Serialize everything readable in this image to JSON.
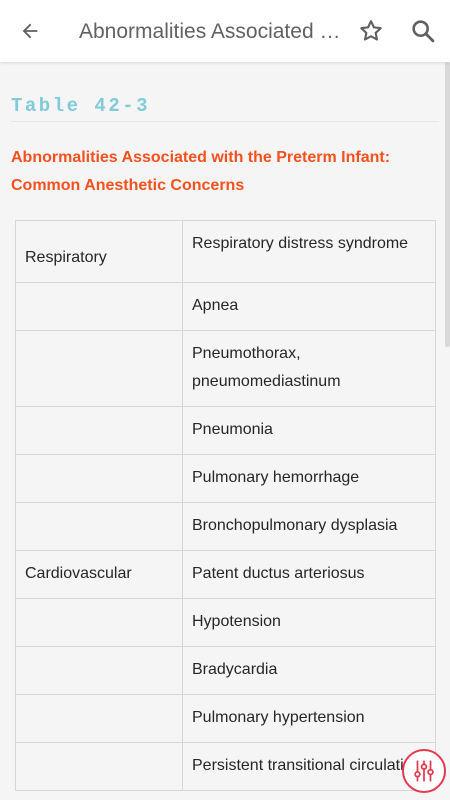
{
  "appbar": {
    "title": "Abnormalities Associated with the Preterm Infant: Common Anesthetic Concerns"
  },
  "table_label": "Table 42-3",
  "caption": "Abnormalities Associated with the Preterm Infant: Common Anesthetic Concerns",
  "rows": [
    {
      "category": "Respiratory",
      "finding": "Respiratory distress syndrome"
    },
    {
      "category": "",
      "finding": "Apnea"
    },
    {
      "category": "",
      "finding": "Pneumothorax, pneumomediastinum"
    },
    {
      "category": "",
      "finding": "Pneumonia"
    },
    {
      "category": "",
      "finding": "Pulmonary hemorrhage"
    },
    {
      "category": "",
      "finding": "Bronchopulmonary dysplasia"
    },
    {
      "category": "Cardiovascular",
      "finding": "Patent ductus arteriosus"
    },
    {
      "category": "",
      "finding": "Hypotension"
    },
    {
      "category": "",
      "finding": "Bradycardia"
    },
    {
      "category": "",
      "finding": "Pulmonary hypertension"
    },
    {
      "category": "",
      "finding": "Persistent transitional circulation"
    }
  ],
  "icons": {
    "back": "arrow-back-icon",
    "star": "star-outline-icon",
    "search": "search-icon",
    "fab": "adjust-sliders-icon"
  },
  "colors": {
    "table_label": "#80cbd9",
    "caption": "#f4511e",
    "fab_accent": "#e53950"
  }
}
